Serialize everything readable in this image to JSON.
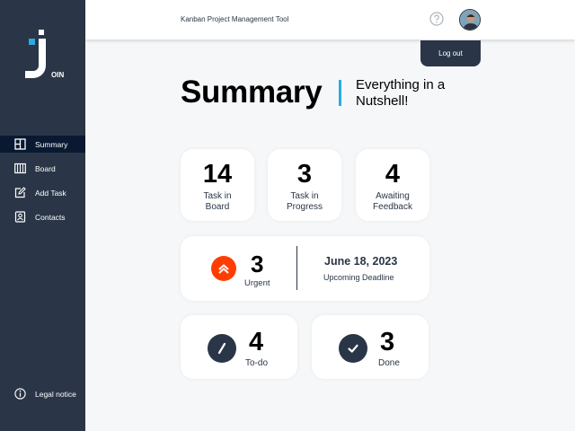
{
  "app": {
    "header_title": "Kanban Project Management Tool",
    "logo_text": "OIN"
  },
  "colors": {
    "sidebar": "#2a3647",
    "sidebar_active": "#091931",
    "accent": "#29abe2",
    "urgent": "#ff3d00"
  },
  "header": {
    "help_icon": "question-circle-icon",
    "avatar": "user-avatar",
    "logout_label": "Log out"
  },
  "sidebar": {
    "items": [
      {
        "label": "Summary",
        "icon": "summary-icon",
        "active": true
      },
      {
        "label": "Board",
        "icon": "board-icon",
        "active": false
      },
      {
        "label": "Add Task",
        "icon": "edit-icon",
        "active": false
      },
      {
        "label": "Contacts",
        "icon": "contacts-icon",
        "active": false
      }
    ],
    "legal_label": "Legal notice"
  },
  "summary": {
    "title": "Summary",
    "subtitle": "Everything in a Nutshell!"
  },
  "stats": [
    {
      "value": "14",
      "label_line1": "Task in",
      "label_line2": "Board"
    },
    {
      "value": "3",
      "label_line1": "Task in",
      "label_line2": "Progress"
    },
    {
      "value": "4",
      "label_line1": "Awaiting",
      "label_line2": "Feedback"
    }
  ],
  "urgent": {
    "value": "3",
    "label": "Urgent",
    "deadline_date": "June 18, 2023",
    "deadline_label": "Upcoming Deadline"
  },
  "todo": {
    "value": "4",
    "label": "To-do",
    "icon": "pencil-icon"
  },
  "done": {
    "value": "3",
    "label": "Done",
    "icon": "check-icon"
  }
}
